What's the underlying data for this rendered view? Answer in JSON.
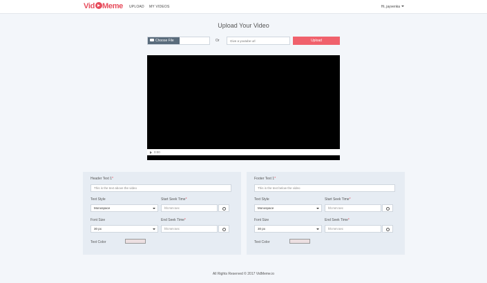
{
  "navbar": {
    "brand_pre": "Vid",
    "brand_post": "Meme",
    "links": [
      "UPLOAD",
      "MY VIDEOS"
    ],
    "user": "Hi, jayvenka"
  },
  "upload": {
    "title": "Upload Your Video",
    "choose_file_label": "Choose File",
    "or_text": "Or",
    "url_placeholder": "Give a youtube url",
    "upload_label": "Upload"
  },
  "player": {
    "time": "0:00"
  },
  "header_panel": {
    "text_label": "Header Text 1",
    "text_placeholder": "This is the text above the video",
    "style_label": "Text Style",
    "style_value": "Monospace",
    "size_label": "Font Size",
    "size_value": "30 px",
    "start_label": "Start Seek Time",
    "start_placeholder": "hh:mm:sec",
    "end_label": "End Seek Time",
    "end_placeholder": "hh:mm:sec",
    "color_label": "Text Color",
    "color_value": "#ecdfe1"
  },
  "footer_panel": {
    "text_label": "Footer Text 1",
    "text_placeholder": "This is the text below the video",
    "style_label": "Text Style",
    "style_value": "Monospace",
    "size_label": "Font Size",
    "size_value": "30 px",
    "start_label": "Start Seek Time",
    "start_placeholder": "hh:mm:sec",
    "end_label": "End Seek Time",
    "end_placeholder": "hh:mm:sec",
    "color_label": "Text Color",
    "color_value": "#ecdfe1"
  },
  "required_mark": "*",
  "footer": {
    "copyright": "All Rights Reserved © 2017 VidMeme.io"
  },
  "colors": {
    "accent": "#f0616c",
    "brand": "#e74c5c",
    "panel_bg": "#e6ecf3",
    "page_bg": "#f3f6fa"
  }
}
